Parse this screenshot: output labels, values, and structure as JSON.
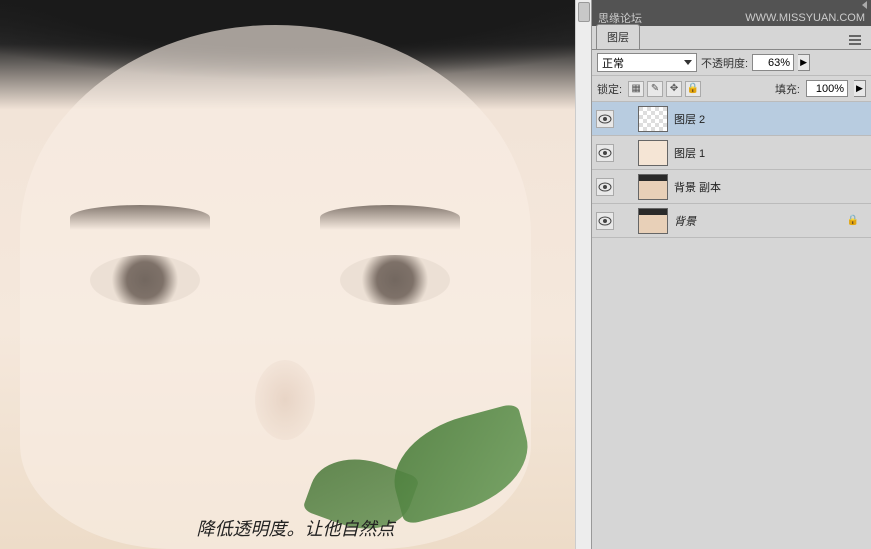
{
  "watermark": {
    "forum": "思缘论坛",
    "url": "WWW.MISSYUAN.COM"
  },
  "panel": {
    "tab_label": "图层"
  },
  "blend": {
    "mode": "正常",
    "opacity_label": "不透明度:",
    "opacity_value": "63%"
  },
  "lock": {
    "label": "锁定:",
    "fill_label": "填充:",
    "fill_value": "100%"
  },
  "layers": [
    {
      "name": "图层 2",
      "selected": true,
      "thumb": "checker"
    },
    {
      "name": "图层 1",
      "selected": false,
      "thumb": "skin"
    },
    {
      "name": "背景 副本",
      "selected": false,
      "thumb": "face"
    },
    {
      "name": "背景",
      "selected": false,
      "thumb": "face",
      "italic": true,
      "locked": true
    }
  ],
  "caption": "降低透明度。让他自然点"
}
